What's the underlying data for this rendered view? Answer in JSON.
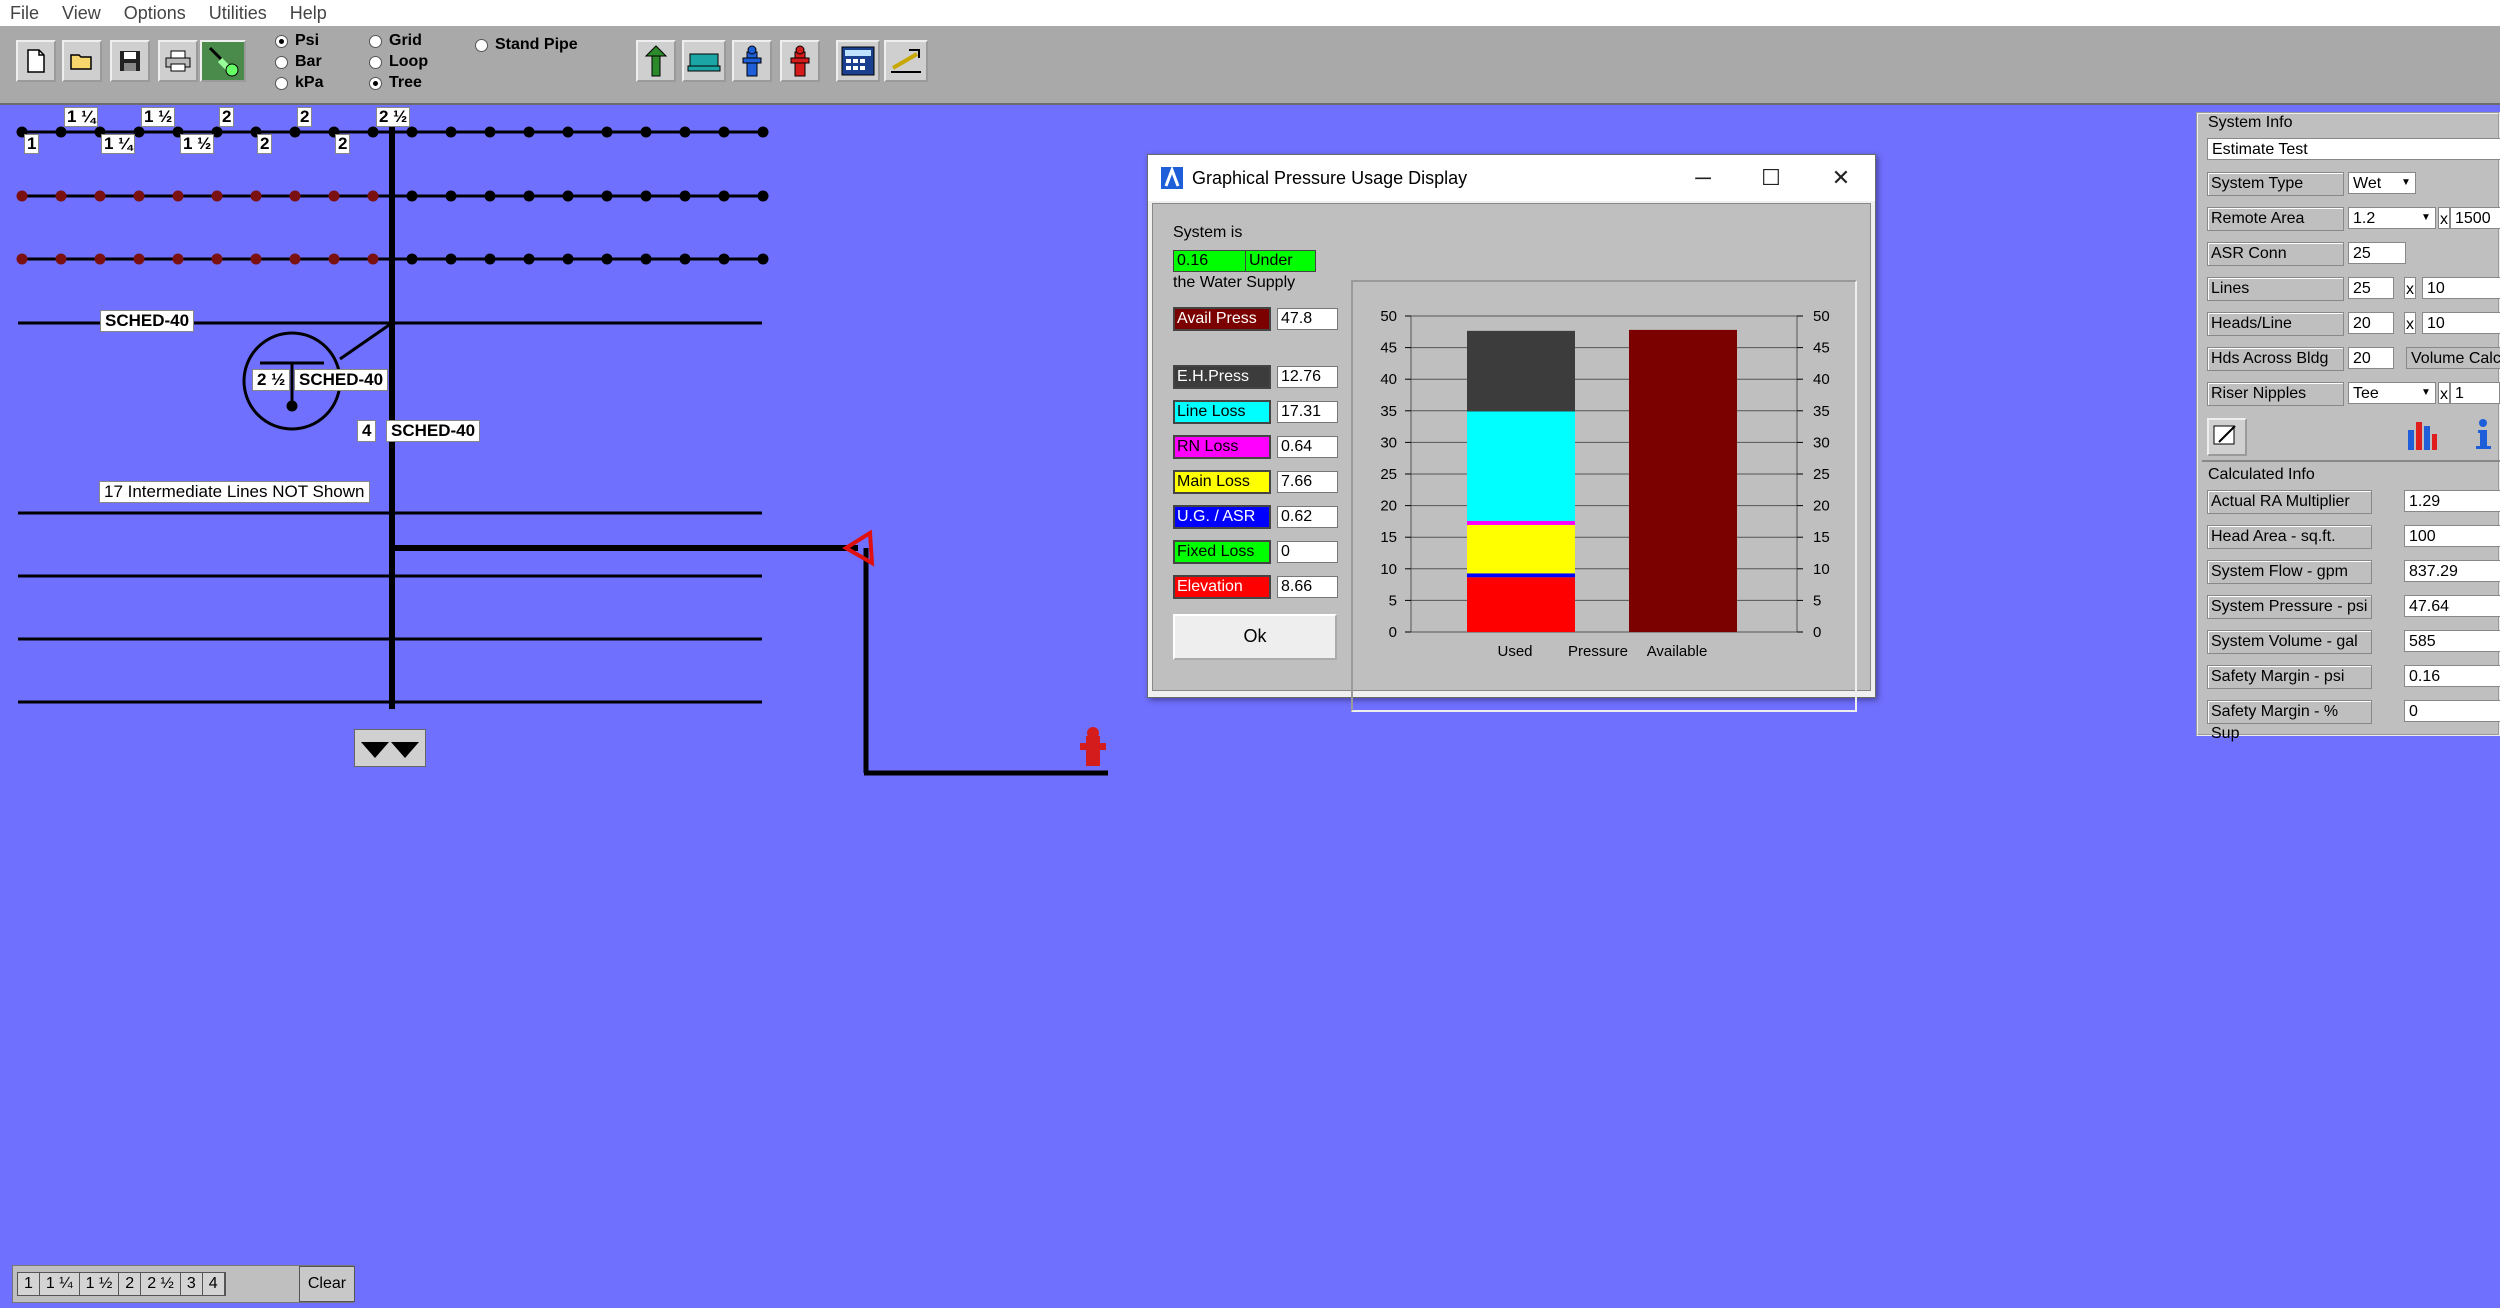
{
  "menu": [
    "File",
    "View",
    "Options",
    "Utilities",
    "Help"
  ],
  "toolbar": {
    "units": [
      {
        "label": "Psi",
        "selected": true
      },
      {
        "label": "Bar",
        "selected": false
      },
      {
        "label": "kPa",
        "selected": false
      }
    ],
    "system_types": [
      {
        "label": "Grid",
        "selected": false
      },
      {
        "label": "Loop",
        "selected": false
      },
      {
        "label": "Tree",
        "selected": true
      }
    ],
    "stand_pipe": {
      "label": "Stand Pipe",
      "selected": false
    },
    "icons": [
      "new-file-icon",
      "open-folder-icon",
      "save-icon",
      "print-icon",
      "sprinkler-icon",
      "green-riser-icon",
      "teal-pump-icon",
      "blue-hydrant-icon",
      "red-hydrant-icon",
      "calculator-icon",
      "graph-tool-icon"
    ]
  },
  "drawing": {
    "top_sizes": [
      "1 ¼",
      "1 ½",
      "2",
      "2",
      "2 ½"
    ],
    "bottom_sizes": [
      "1",
      "1 ¼",
      "1 ½",
      "2",
      "2"
    ],
    "sched_line": "SCHED-40",
    "riser_size": "2 ½",
    "riser_sched": "SCHED-40",
    "main_size": "4",
    "main_sched": "SCHED-40",
    "note": "17 Intermediate Lines NOT Shown"
  },
  "dialog": {
    "title": "Graphical Pressure Usage Display",
    "status_prefix": "System is",
    "margin_value": "0.16",
    "margin_state": "Under",
    "status_suffix": "the Water Supply",
    "avail_label": "Avail Press",
    "avail_value": "47.8",
    "avail_color": "#7b0000",
    "losses": [
      {
        "label": "E.H.Press",
        "value": "12.76",
        "color": "#3c3c3c",
        "text_color": "#ffffff"
      },
      {
        "label": "Line Loss",
        "value": "17.31",
        "color": "#00ffff",
        "text_color": "#000000"
      },
      {
        "label": "RN Loss",
        "value": "0.64",
        "color": "#ff00ff",
        "text_color": "#000000"
      },
      {
        "label": "Main Loss",
        "value": "7.66",
        "color": "#ffff00",
        "text_color": "#000000"
      },
      {
        "label": "U.G. / ASR",
        "value": "0.62",
        "color": "#0000ff",
        "text_color": "#ffffff"
      },
      {
        "label": "Fixed Loss",
        "value": "0",
        "color": "#00ff00",
        "text_color": "#000000"
      },
      {
        "label": "Elevation",
        "value": "8.66",
        "color": "#ff0000",
        "text_color": "#ffffff"
      }
    ],
    "ok_label": "Ok"
  },
  "chart_data": {
    "type": "bar",
    "stacked": true,
    "categories": [
      "Used",
      "Available"
    ],
    "x_caption": "Pressure",
    "ylim": [
      0,
      50
    ],
    "yticks": [
      0,
      5,
      10,
      15,
      20,
      25,
      30,
      35,
      40,
      45,
      50
    ],
    "series": [
      {
        "name": "Elevation",
        "values": [
          8.66,
          0
        ],
        "color": "#ff0000"
      },
      {
        "name": "Fixed Loss",
        "values": [
          0,
          0
        ],
        "color": "#00ff00"
      },
      {
        "name": "U.G. / ASR",
        "values": [
          0.62,
          0
        ],
        "color": "#0000ff"
      },
      {
        "name": "Main Loss",
        "values": [
          7.66,
          0
        ],
        "color": "#ffff00"
      },
      {
        "name": "RN Loss",
        "values": [
          0.64,
          0
        ],
        "color": "#ff00ff"
      },
      {
        "name": "Line Loss",
        "values": [
          17.31,
          0
        ],
        "color": "#00ffff"
      },
      {
        "name": "E.H.Press",
        "values": [
          12.76,
          0
        ],
        "color": "#3c3c3c"
      },
      {
        "name": "Avail Press",
        "values": [
          0,
          47.8
        ],
        "color": "#7b0000"
      }
    ]
  },
  "system_info": {
    "title": "System Info",
    "name": "Estimate Test",
    "system_type_label": "System Type",
    "system_type": "Wet",
    "remote_area_label": "Remote Area",
    "remote_area_mult": "1.2",
    "remote_area_size": "1500",
    "asr_conn_label": "ASR Conn",
    "asr_conn": "25",
    "lines_label": "Lines",
    "lines_a": "25",
    "lines_b": "10",
    "heads_line_label": "Heads/Line",
    "heads_line_a": "20",
    "heads_line_b": "10",
    "hds_across_label": "Hds Across Bldg",
    "hds_across": "20",
    "calc_mode": "Volume Calc",
    "riser_nipples_label": "Riser Nipples",
    "riser_nipples": "Tee",
    "riser_nipples_count": "1",
    "x": "x"
  },
  "calculated_info": {
    "title": "Calculated Info",
    "rows": [
      {
        "label": "Actual RA Multiplier",
        "value": "1.29"
      },
      {
        "label": "Head Area - sq.ft.",
        "value": "100"
      },
      {
        "label": "System Flow - gpm",
        "value": "837.29"
      },
      {
        "label": "System Pressure - psi",
        "value": "47.64"
      },
      {
        "label": "System Volume - gal",
        "value": "585"
      },
      {
        "label": "Safety Margin - psi",
        "value": "0.16"
      },
      {
        "label": "Safety Margin - % Sup",
        "value": "0"
      }
    ]
  },
  "bottom": {
    "sizes": [
      "1",
      "1 ¼",
      "1 ½",
      "2",
      "2 ½",
      "3",
      "4"
    ],
    "clear_label": "Clear"
  }
}
